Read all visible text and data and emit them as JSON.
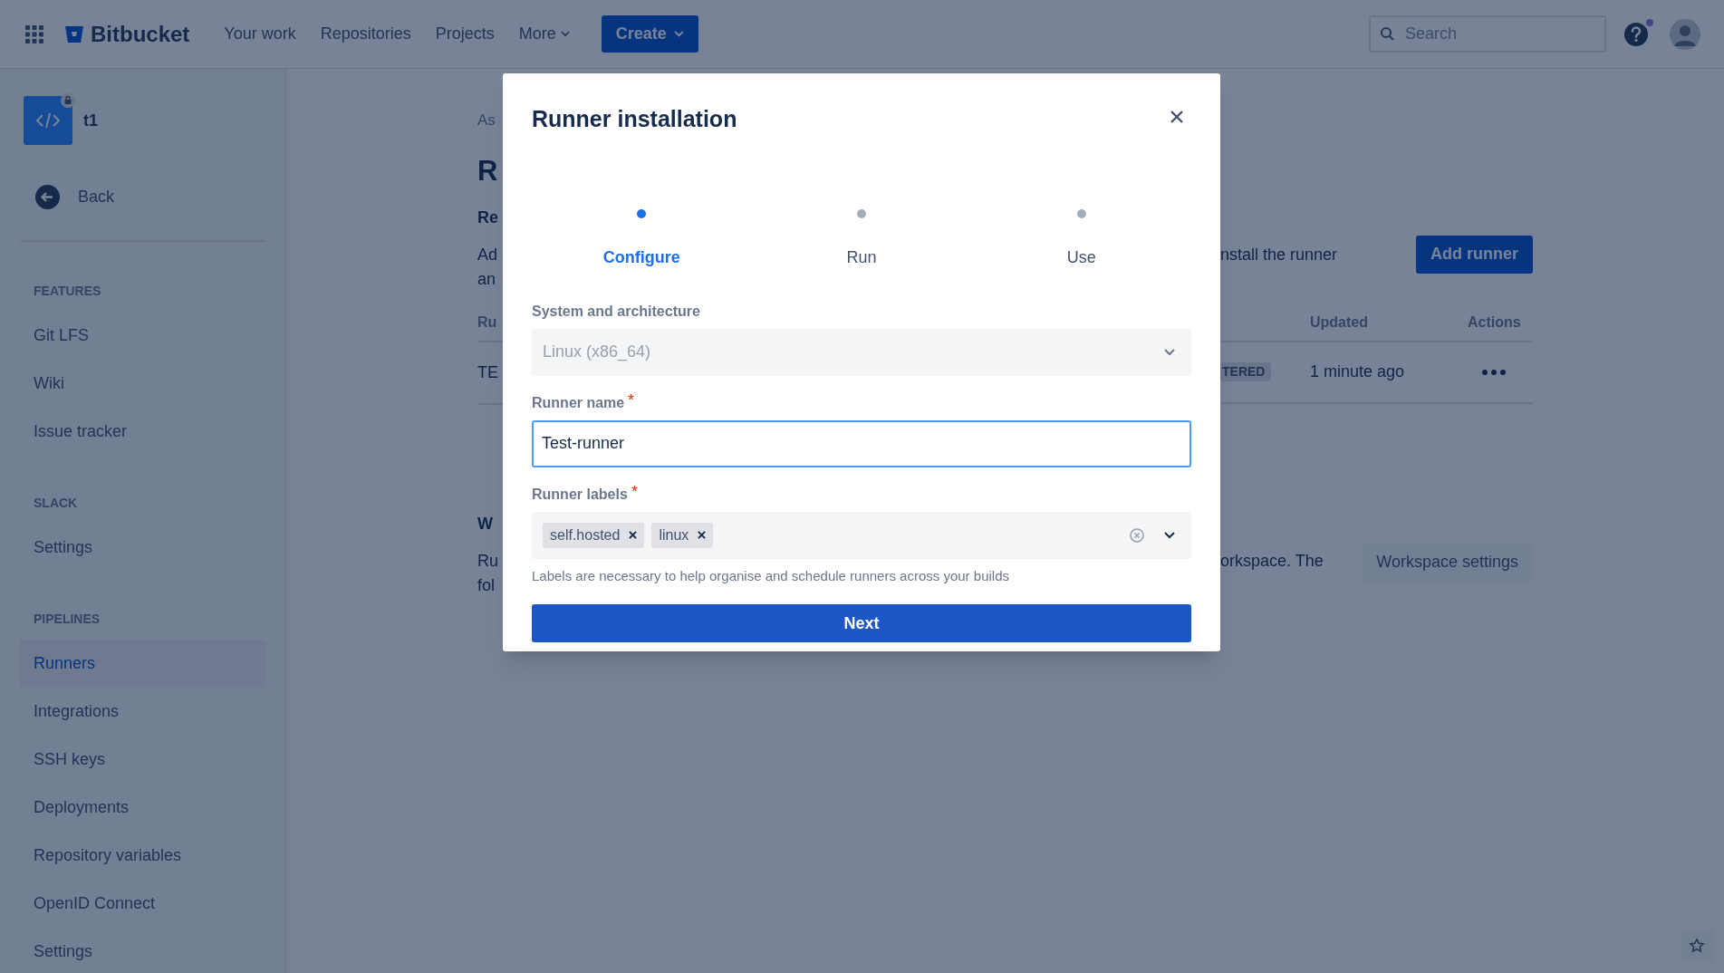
{
  "top_nav": {
    "product": "Bitbucket",
    "links": [
      "Your work",
      "Repositories",
      "Projects"
    ],
    "more": "More",
    "create": "Create",
    "search": {
      "placeholder": "Search"
    }
  },
  "sidebar": {
    "repo": "t1",
    "back": "Back",
    "sections": [
      {
        "heading": "FEATURES",
        "items": [
          {
            "label": "Git LFS",
            "selected": false
          },
          {
            "label": "Wiki",
            "selected": false
          },
          {
            "label": "Issue tracker",
            "selected": false
          }
        ]
      },
      {
        "heading": "SLACK",
        "items": [
          {
            "label": "Settings",
            "selected": false
          }
        ]
      },
      {
        "heading": "PIPELINES",
        "items": [
          {
            "label": "Runners",
            "selected": true
          },
          {
            "label": "Integrations",
            "selected": false
          },
          {
            "label": "SSH keys",
            "selected": false
          },
          {
            "label": "Deployments",
            "selected": false
          },
          {
            "label": "Repository variables",
            "selected": false
          },
          {
            "label": "OpenID Connect",
            "selected": false
          },
          {
            "label": "Settings",
            "selected": false
          }
        ]
      }
    ]
  },
  "page": {
    "breadcrumb": "As",
    "title": "R",
    "section_heading": "Re",
    "description_lines": [
      "Ad",
      "an"
    ],
    "description_end": "nstall the runner",
    "add_button": "Add runner",
    "table": {
      "column_1": "Ru",
      "columns": [
        "Updated",
        "Actions"
      ],
      "rows": [
        {
          "name": "TE",
          "status": "TERED",
          "updated": "1 minute ago"
        }
      ]
    },
    "workspace_heading": "W",
    "workspace_lines": [
      "Ru",
      "fol"
    ],
    "workspace_end": "orkspace. The",
    "workspace_button": "Workspace settings"
  },
  "modal": {
    "title": "Runner installation",
    "steps": [
      {
        "label": "Configure",
        "selected": true
      },
      {
        "label": "Run",
        "selected": false
      },
      {
        "label": "Use",
        "selected": false
      }
    ],
    "system": {
      "label": "System and architecture",
      "value": "Linux (x86_64)",
      "disabled": true
    },
    "runner_name": {
      "label": "Runner name",
      "required": true,
      "value": "Test-runner"
    },
    "runner_labels": {
      "label": "Runner labels",
      "required": true,
      "tags": [
        "self.hosted",
        "linux"
      ],
      "helper": "Labels are necessary to help organise and schedule runners across your builds"
    },
    "next": "Next"
  }
}
